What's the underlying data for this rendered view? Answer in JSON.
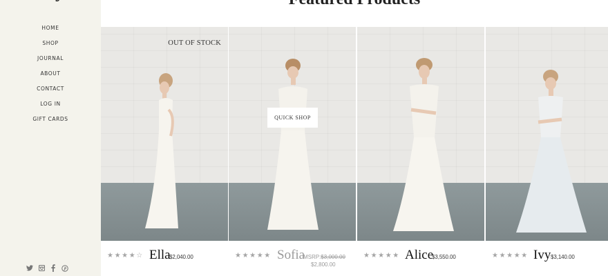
{
  "page": {
    "heading": "Featured Products",
    "logo_fragment": "y"
  },
  "sidebar": {
    "nav": [
      "HOME",
      "SHOP",
      "JOURNAL",
      "ABOUT",
      "CONTACT",
      "LOG IN",
      "GIFT CARDS"
    ],
    "social": [
      "twitter-icon",
      "instagram-icon",
      "facebook-icon",
      "pinterest-icon"
    ]
  },
  "products": [
    {
      "name": "Ella",
      "price": "$2,040.00",
      "rating": 4,
      "badge": "OUT OF STOCK"
    },
    {
      "name": "Sofia",
      "msrp_label": "MSRP:",
      "msrp_price": "$3,000.00",
      "sale_price": "$2,800.00",
      "rating": 5,
      "overlay": "QUICK SHOP"
    },
    {
      "name": "Alice",
      "price": "$3,550.00",
      "rating": 5
    },
    {
      "name": "Ivy",
      "price": "$3,140.00",
      "rating": 5
    }
  ],
  "colors": {
    "sidebar_bg": "#f4f3ec",
    "star": "#a5a5a5",
    "muted": "#9a9a9a"
  }
}
